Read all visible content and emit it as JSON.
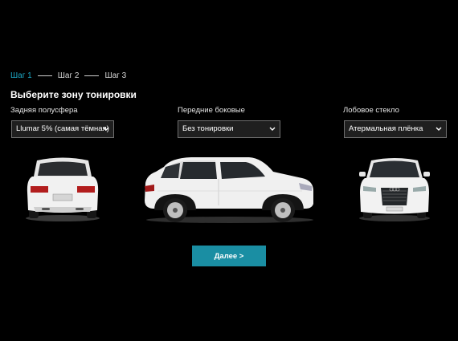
{
  "steps": [
    "Шаг 1",
    "Шаг 2",
    "Шаг 3"
  ],
  "heading": "Выберите зону тонировки",
  "zones": [
    {
      "label": "Задняя полусфера",
      "value": "Llumar 5% (самая тёмная)"
    },
    {
      "label": "Передние боковые",
      "value": "Без тонировки"
    },
    {
      "label": "Лобовое стекло",
      "value": "Атермальная плёнка"
    }
  ],
  "next_label": "Далее >",
  "colors": {
    "accent": "#1da7c4",
    "button": "#1a8ea3",
    "background": "#000000"
  }
}
